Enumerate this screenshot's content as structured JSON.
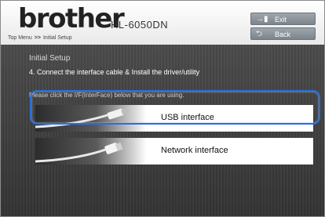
{
  "header": {
    "logo": "brother",
    "model": "HL-6050DN",
    "breadcrumb": {
      "home": "Top Menu",
      "separator": ">>",
      "current": "Initial Setup"
    },
    "buttons": {
      "exit": "Exit",
      "back": "Back"
    }
  },
  "content": {
    "title": "Initial Setup",
    "step": "4. Connect the interface cable & Install the driver/utility",
    "instruction": "Please click the I/F(InterFace) below that you are using.",
    "options": [
      {
        "label": "USB interface",
        "icon": "usb-cable-icon"
      },
      {
        "label": "Network interface",
        "icon": "network-cable-icon",
        "highlighted": true
      }
    ]
  },
  "colors": {
    "highlight": "#2b6fd6",
    "background": "#3a3a3a",
    "header_button": "#8a9199"
  }
}
